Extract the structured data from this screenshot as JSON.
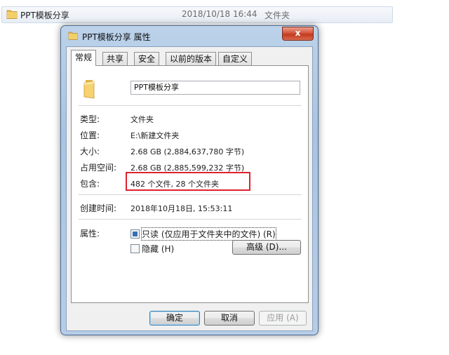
{
  "explorer": {
    "name": "PPT模板分享",
    "date": "2018/10/18 16:44",
    "type": "文件夹"
  },
  "dialog": {
    "title": "PPT模板分享 属性",
    "close_label": "x",
    "tabs": [
      "常规",
      "共享",
      "安全",
      "以前的版本",
      "自定义"
    ],
    "folder_name": "PPT模板分享",
    "rows": [
      {
        "label": "类型:",
        "value": "文件夹"
      },
      {
        "label": "位置:",
        "value": "E:\\新建文件夹"
      },
      {
        "label": "大小:",
        "value": "2.68 GB (2,884,637,780 字节)"
      },
      {
        "label": "占用空间:",
        "value": "2.68 GB (2,885,599,232 字节)"
      },
      {
        "label": "包含:",
        "value": "482 个文件, 28 个文件夹"
      }
    ],
    "created": {
      "label": "创建时间:",
      "value": "2018年10月18日, 15:53:11"
    },
    "attributes": {
      "label": "属性:",
      "readonly_label": "只读 (仅应用于文件夹中的文件) (R)",
      "hidden_label": "隐藏 (H)",
      "advanced_label": "高级 (D)..."
    },
    "buttons": {
      "ok": "确定",
      "cancel": "取消",
      "apply": "应用 (A)"
    }
  }
}
